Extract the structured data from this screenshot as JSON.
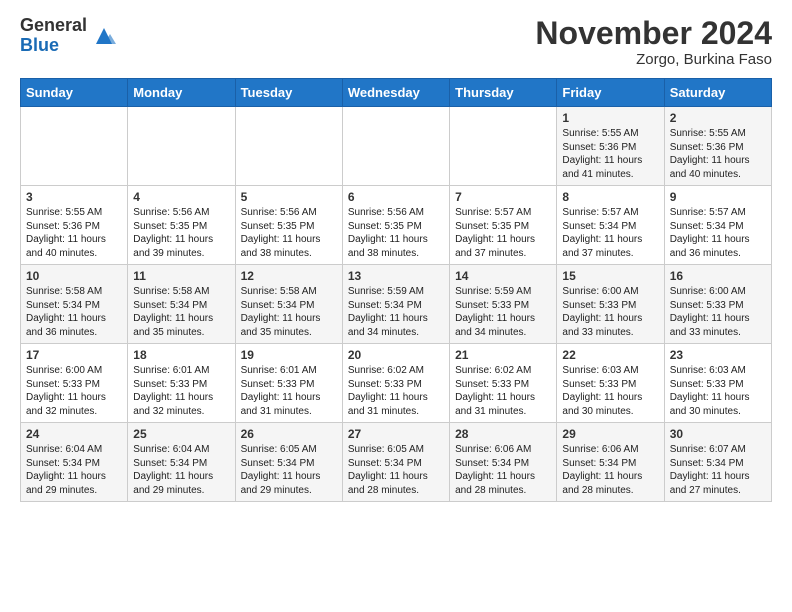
{
  "header": {
    "logo_line1": "General",
    "logo_line2": "Blue",
    "month": "November 2024",
    "location": "Zorgo, Burkina Faso"
  },
  "weekdays": [
    "Sunday",
    "Monday",
    "Tuesday",
    "Wednesday",
    "Thursday",
    "Friday",
    "Saturday"
  ],
  "weeks": [
    [
      {
        "day": "",
        "text": ""
      },
      {
        "day": "",
        "text": ""
      },
      {
        "day": "",
        "text": ""
      },
      {
        "day": "",
        "text": ""
      },
      {
        "day": "",
        "text": ""
      },
      {
        "day": "1",
        "text": "Sunrise: 5:55 AM\nSunset: 5:36 PM\nDaylight: 11 hours\nand 41 minutes."
      },
      {
        "day": "2",
        "text": "Sunrise: 5:55 AM\nSunset: 5:36 PM\nDaylight: 11 hours\nand 40 minutes."
      }
    ],
    [
      {
        "day": "3",
        "text": "Sunrise: 5:55 AM\nSunset: 5:36 PM\nDaylight: 11 hours\nand 40 minutes."
      },
      {
        "day": "4",
        "text": "Sunrise: 5:56 AM\nSunset: 5:35 PM\nDaylight: 11 hours\nand 39 minutes."
      },
      {
        "day": "5",
        "text": "Sunrise: 5:56 AM\nSunset: 5:35 PM\nDaylight: 11 hours\nand 38 minutes."
      },
      {
        "day": "6",
        "text": "Sunrise: 5:56 AM\nSunset: 5:35 PM\nDaylight: 11 hours\nand 38 minutes."
      },
      {
        "day": "7",
        "text": "Sunrise: 5:57 AM\nSunset: 5:35 PM\nDaylight: 11 hours\nand 37 minutes."
      },
      {
        "day": "8",
        "text": "Sunrise: 5:57 AM\nSunset: 5:34 PM\nDaylight: 11 hours\nand 37 minutes."
      },
      {
        "day": "9",
        "text": "Sunrise: 5:57 AM\nSunset: 5:34 PM\nDaylight: 11 hours\nand 36 minutes."
      }
    ],
    [
      {
        "day": "10",
        "text": "Sunrise: 5:58 AM\nSunset: 5:34 PM\nDaylight: 11 hours\nand 36 minutes."
      },
      {
        "day": "11",
        "text": "Sunrise: 5:58 AM\nSunset: 5:34 PM\nDaylight: 11 hours\nand 35 minutes."
      },
      {
        "day": "12",
        "text": "Sunrise: 5:58 AM\nSunset: 5:34 PM\nDaylight: 11 hours\nand 35 minutes."
      },
      {
        "day": "13",
        "text": "Sunrise: 5:59 AM\nSunset: 5:34 PM\nDaylight: 11 hours\nand 34 minutes."
      },
      {
        "day": "14",
        "text": "Sunrise: 5:59 AM\nSunset: 5:33 PM\nDaylight: 11 hours\nand 34 minutes."
      },
      {
        "day": "15",
        "text": "Sunrise: 6:00 AM\nSunset: 5:33 PM\nDaylight: 11 hours\nand 33 minutes."
      },
      {
        "day": "16",
        "text": "Sunrise: 6:00 AM\nSunset: 5:33 PM\nDaylight: 11 hours\nand 33 minutes."
      }
    ],
    [
      {
        "day": "17",
        "text": "Sunrise: 6:00 AM\nSunset: 5:33 PM\nDaylight: 11 hours\nand 32 minutes."
      },
      {
        "day": "18",
        "text": "Sunrise: 6:01 AM\nSunset: 5:33 PM\nDaylight: 11 hours\nand 32 minutes."
      },
      {
        "day": "19",
        "text": "Sunrise: 6:01 AM\nSunset: 5:33 PM\nDaylight: 11 hours\nand 31 minutes."
      },
      {
        "day": "20",
        "text": "Sunrise: 6:02 AM\nSunset: 5:33 PM\nDaylight: 11 hours\nand 31 minutes."
      },
      {
        "day": "21",
        "text": "Sunrise: 6:02 AM\nSunset: 5:33 PM\nDaylight: 11 hours\nand 31 minutes."
      },
      {
        "day": "22",
        "text": "Sunrise: 6:03 AM\nSunset: 5:33 PM\nDaylight: 11 hours\nand 30 minutes."
      },
      {
        "day": "23",
        "text": "Sunrise: 6:03 AM\nSunset: 5:33 PM\nDaylight: 11 hours\nand 30 minutes."
      }
    ],
    [
      {
        "day": "24",
        "text": "Sunrise: 6:04 AM\nSunset: 5:34 PM\nDaylight: 11 hours\nand 29 minutes."
      },
      {
        "day": "25",
        "text": "Sunrise: 6:04 AM\nSunset: 5:34 PM\nDaylight: 11 hours\nand 29 minutes."
      },
      {
        "day": "26",
        "text": "Sunrise: 6:05 AM\nSunset: 5:34 PM\nDaylight: 11 hours\nand 29 minutes."
      },
      {
        "day": "27",
        "text": "Sunrise: 6:05 AM\nSunset: 5:34 PM\nDaylight: 11 hours\nand 28 minutes."
      },
      {
        "day": "28",
        "text": "Sunrise: 6:06 AM\nSunset: 5:34 PM\nDaylight: 11 hours\nand 28 minutes."
      },
      {
        "day": "29",
        "text": "Sunrise: 6:06 AM\nSunset: 5:34 PM\nDaylight: 11 hours\nand 28 minutes."
      },
      {
        "day": "30",
        "text": "Sunrise: 6:07 AM\nSunset: 5:34 PM\nDaylight: 11 hours\nand 27 minutes."
      }
    ]
  ]
}
